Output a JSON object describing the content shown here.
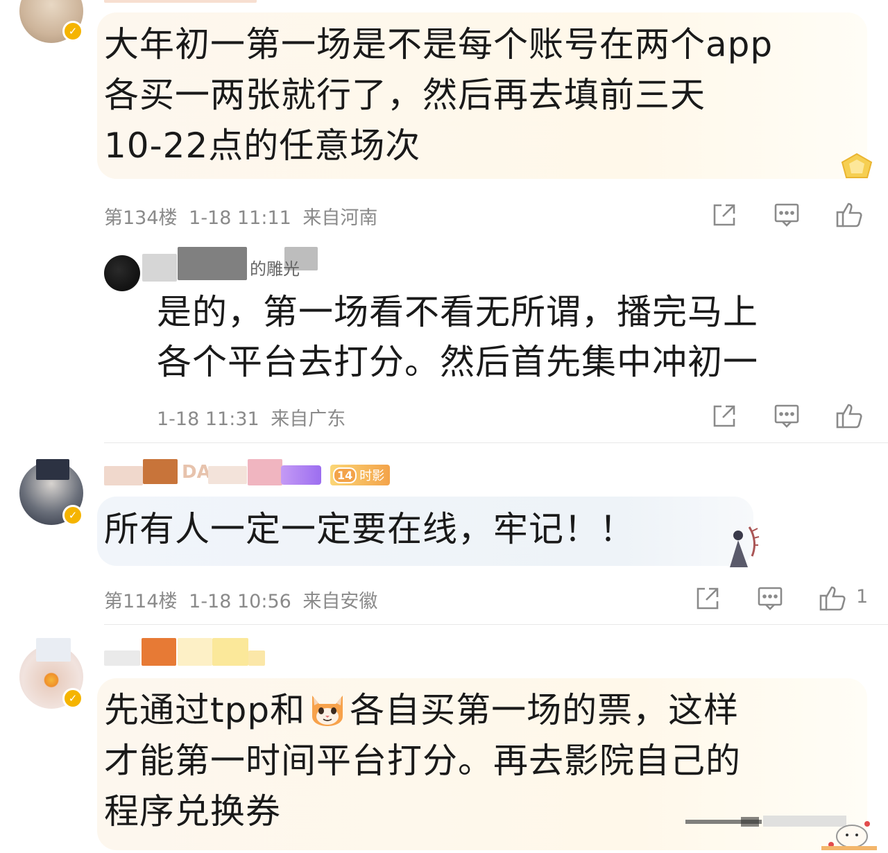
{
  "comments": [
    {
      "text_lines": [
        "大年初一第一场是不是每个账号在两个app",
        "各买一两张就行了，然后再去填前三天",
        "10-22点的任意场次"
      ],
      "floor": "第134楼",
      "time": "1-18 11:11",
      "location": "来自河南"
    },
    {
      "reply": true,
      "name_fragment": "的雕光",
      "text_lines": [
        "是的，第一场看不看无所谓，播完马上",
        "各个平台去打分。然后首先集中冲初一"
      ],
      "time": "1-18 11:31",
      "location": "来自广东"
    },
    {
      "name_fragment": "DA",
      "badge_level": "14",
      "badge_text": "时影",
      "text_lines": [
        "所有人一定一定要在线，牢记！！"
      ],
      "floor": "第114楼",
      "time": "1-18 10:56",
      "location": "来自安徽",
      "like_count": "1"
    },
    {
      "text_lines_1_a": "先通过tpp和",
      "text_lines_1_b": "各自买第一场的票，这样",
      "text_lines": [
        "才能第一时间平台打分。再去影院自己的",
        "程序兑换券"
      ]
    }
  ],
  "icons": {
    "share": "share-icon",
    "comment": "comment-icon",
    "like": "thumbs-up-icon",
    "verified": "verified-badge-icon",
    "cat_emoji": "cat-face-emoji"
  },
  "colors": {
    "verified": "#f5b400",
    "meta_text": "#8a8a8a",
    "badge_purple": "#b07cf0",
    "badge_orange": "#f3a34a"
  }
}
